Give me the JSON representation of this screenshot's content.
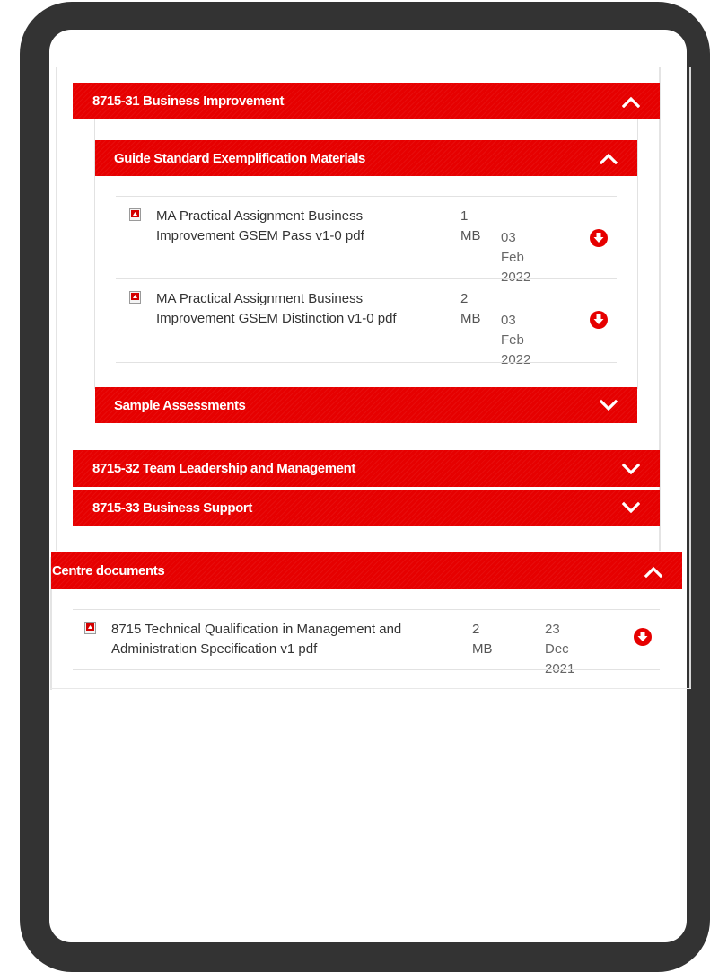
{
  "sections": {
    "business_improvement": {
      "title": "8715-31 Business Improvement"
    },
    "guide_standard": {
      "title": "Guide Standard Exemplification Materials"
    },
    "sample_assessments": {
      "title": "Sample Assessments"
    },
    "team_leadership": {
      "title": "8715-32 Team Leadership and Management"
    },
    "business_support": {
      "title": "8715-33 Business Support"
    },
    "centre_documents": {
      "title": "Centre documents"
    }
  },
  "files": [
    {
      "name_line1": "MA Practical Assignment Business",
      "name_line2": "Improvement GSEM Pass v1-0 pdf",
      "size": "1 MB",
      "date_line1": "03 Feb",
      "date_line2": "2022"
    },
    {
      "name_line1": "MA Practical Assignment Business",
      "name_line2": "Improvement GSEM Distinction v1-0 pdf",
      "size": "2 MB",
      "date_line1": "03 Feb",
      "date_line2": "2022"
    },
    {
      "name_line1": "8715 Technical Qualification in Management and",
      "name_line2": "Administration Specification v1 pdf",
      "size": "2 MB",
      "date_line1": "23 Dec",
      "date_line2": "2021"
    }
  ],
  "icons": {
    "pdf": "pdf-file-icon",
    "download": "download-circle-icon",
    "chevron_up": "chevron-up-icon",
    "chevron_down": "chevron-down-icon"
  },
  "colors": {
    "accent": "#e60000",
    "frame": "#333333"
  }
}
